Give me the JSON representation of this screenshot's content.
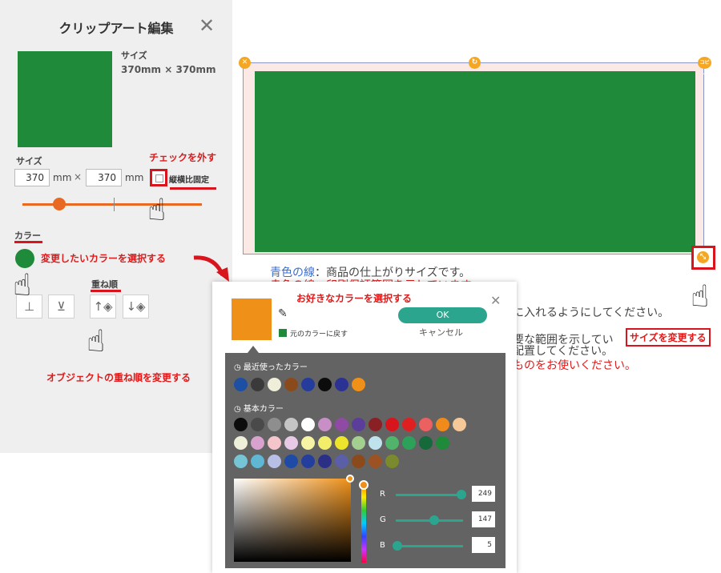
{
  "panel": {
    "title": "クリップアート編集",
    "close": "✕",
    "size_head": "サイズ",
    "size_value": "370mm × 370mm",
    "size_label": "サイズ",
    "width_value": "370",
    "height_value": "370",
    "unit1": "mm",
    "times": "×",
    "unit2": "mm",
    "lock_label": "縦横比固定",
    "color_label": "カラー",
    "order_label": "重ね順",
    "order_buttons": [
      "⊥",
      "⊻",
      "↑◈",
      "↓◈"
    ]
  },
  "notes": {
    "uncheck": "チェックを外す",
    "change_color": "変更したいカラーを選択する",
    "change_order": "オブジェクトの重ね順を変更する",
    "pick_color": "お好きなカラーを選択する",
    "resize": "サイズを変更する"
  },
  "canvas": {
    "handle_close": "✕",
    "handle_rotate": "↻",
    "handle_copy": "コピー",
    "handle_resize": "⤡",
    "info_blue": "青色の線",
    "info_line1": "：商品の仕上がりサイズです。",
    "info_line2": "赤色の線：印刷保証範囲を示しています",
    "info_line3": "に入れるようにしてください。",
    "info_line4": "要な範囲を示してい",
    "info_line5": "配置してください。",
    "info_line6": "ものをお使いください。"
  },
  "picker": {
    "eyedropper": "✎",
    "revert_label": "元のカラーに戻す",
    "ok": "OK",
    "cancel": "キャンセル",
    "close": "✕",
    "recent_title": "最近使ったカラー",
    "basic_title": "基本カラー",
    "recent": [
      "#1d4fa3",
      "#3a3a3a",
      "#efeed8",
      "#8a4a1c",
      "#253c9c",
      "#0c0c0c",
      "#2b3294",
      "#ef9018"
    ],
    "basic": [
      [
        "#0c0c0c",
        "#4a4a4a",
        "#8e8e8e",
        "#c5c5c5",
        "#ffffff",
        "#c78fc5",
        "#8f4aa4",
        "#5b3d9a",
        "#8a1f24",
        "#d8141c",
        "#e02020",
        "#eb6060",
        "#f08a1a",
        "#f5c89a"
      ],
      [
        "#efeed8",
        "#d9a2ce",
        "#f5c5cc",
        "#e8c9e5",
        "#f7f5a5",
        "#f3ee6a",
        "#ede52b",
        "#a3cf8f",
        "#bfe2ec",
        "#50b46a",
        "#2da05a",
        "#16693a",
        "#1e8a3a"
      ],
      [
        "#76c5d6",
        "#5fb7d4",
        "#b7bfe6",
        "#1f4aa6",
        "#243e9d",
        "#2c2f86",
        "#5a5fa8",
        "#8a4a1c",
        "#9c5222",
        "#7a8a2c"
      ]
    ],
    "r_label": "R",
    "g_label": "G",
    "b_label": "B",
    "r_value": "249",
    "g_value": "147",
    "b_value": "5",
    "rgb": [
      249,
      147,
      5
    ]
  },
  "colors": {
    "accent_red": "#d8141c",
    "clip_green": "#1e8a3a",
    "selected_orange": "#ef9018",
    "teal": "#2ba58d"
  }
}
